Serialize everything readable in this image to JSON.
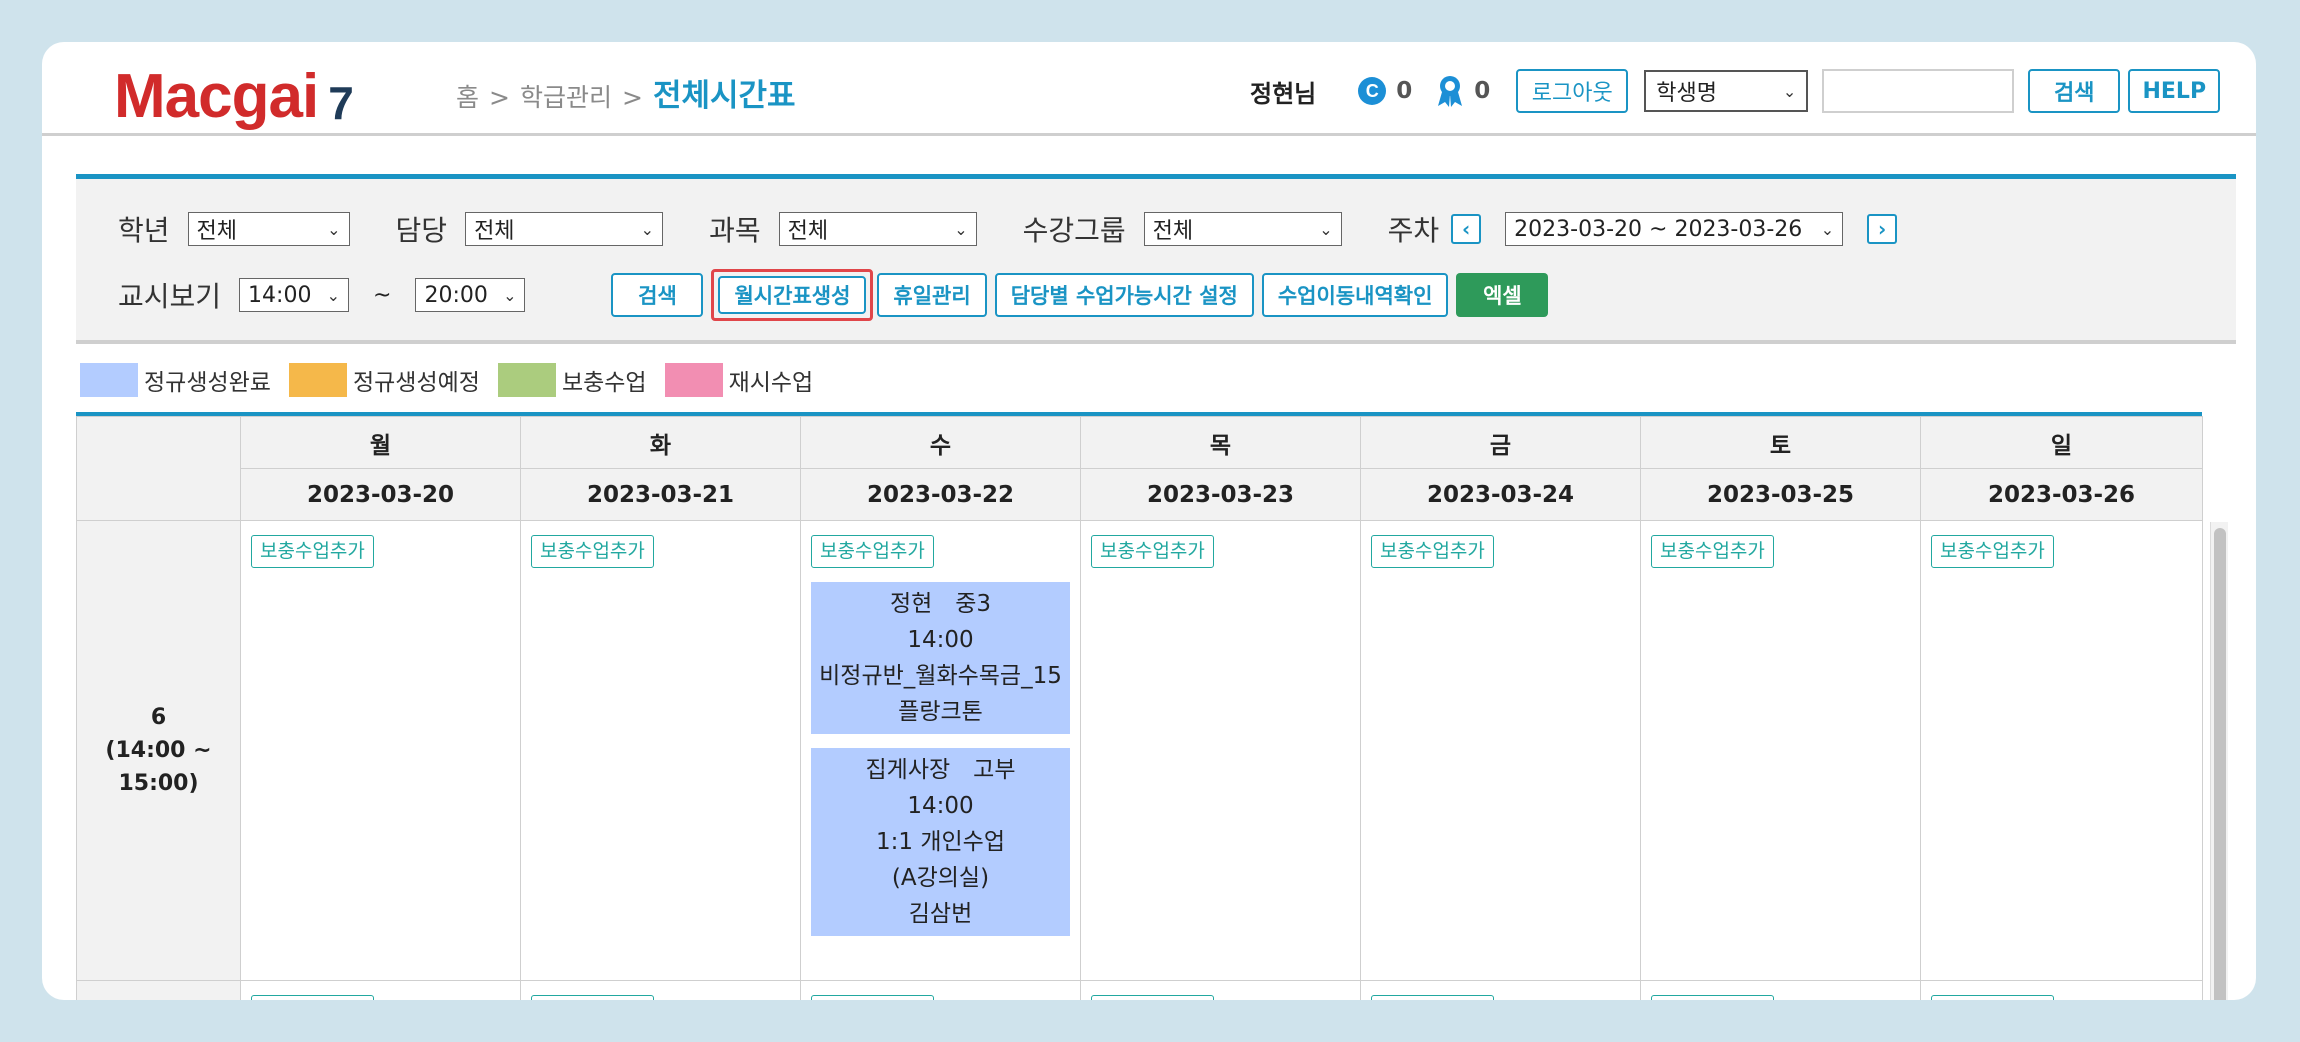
{
  "header": {
    "logo_text": "Macgai",
    "logo_version": "7",
    "breadcrumb": {
      "home": "홈",
      "separator": ">",
      "section": "학급관리",
      "current": "전체시간표"
    },
    "user_name": "정현님",
    "coin_icon_letter": "C",
    "coin_count": "0",
    "badge_count": "0",
    "logout_label": "로그아웃",
    "name_select_value": "학생명",
    "search_value": "",
    "search_label": "검색",
    "help_label": "HELP"
  },
  "filters": {
    "grade_label": "학년",
    "grade_value": "전체",
    "teacher_label": "담당",
    "teacher_value": "전체",
    "subject_label": "과목",
    "subject_value": "전체",
    "group_label": "수강그룹",
    "group_value": "전체",
    "week_label": "주차",
    "week_value": "2023-03-20 ~ 2023-03-26",
    "period_label": "교시보기",
    "period_from": "14:00",
    "tilde": "~",
    "period_to": "20:00"
  },
  "actions": {
    "search": "검색",
    "create_monthly": "월시간표생성",
    "holiday": "휴일관리",
    "teacher_hours": "담당별 수업가능시간 설정",
    "move_history": "수업이동내역확인",
    "excel": "엑셀"
  },
  "legend": [
    {
      "label": "정규생성완료",
      "color": "#b3ccff"
    },
    {
      "label": "정규생성예정",
      "color": "#f5b84a"
    },
    {
      "label": "보충수업",
      "color": "#abcc7e"
    },
    {
      "label": "재시수업",
      "color": "#f28eb2"
    }
  ],
  "schedule": {
    "days": [
      {
        "day": "월",
        "date": "2023-03-20"
      },
      {
        "day": "화",
        "date": "2023-03-21"
      },
      {
        "day": "수",
        "date": "2023-03-22"
      },
      {
        "day": "목",
        "date": "2023-03-23"
      },
      {
        "day": "금",
        "date": "2023-03-24"
      },
      {
        "day": "토",
        "date": "2023-03-25"
      },
      {
        "day": "일",
        "date": "2023-03-26"
      }
    ],
    "add_label": "보충수업추가",
    "period": {
      "number": "6",
      "time": "(14:00 ~",
      "end": "15:00)"
    },
    "lessons": [
      {
        "line1": "정현　중3",
        "time": "14:00",
        "class_name": "비정규반_월화수목금_15",
        "room": "플랑크톤"
      },
      {
        "line1": "집게사장　고부",
        "time": "14:00",
        "class_name": "1:1 개인수업",
        "room": "(A강의실)",
        "teacher": "김삼번"
      }
    ]
  },
  "colors": {
    "accent": "#1a94c4",
    "logo_red": "#d12b2b",
    "teal": "#22a8a0",
    "excel_green": "#2e9a5a",
    "highlight": "#e0464a"
  }
}
